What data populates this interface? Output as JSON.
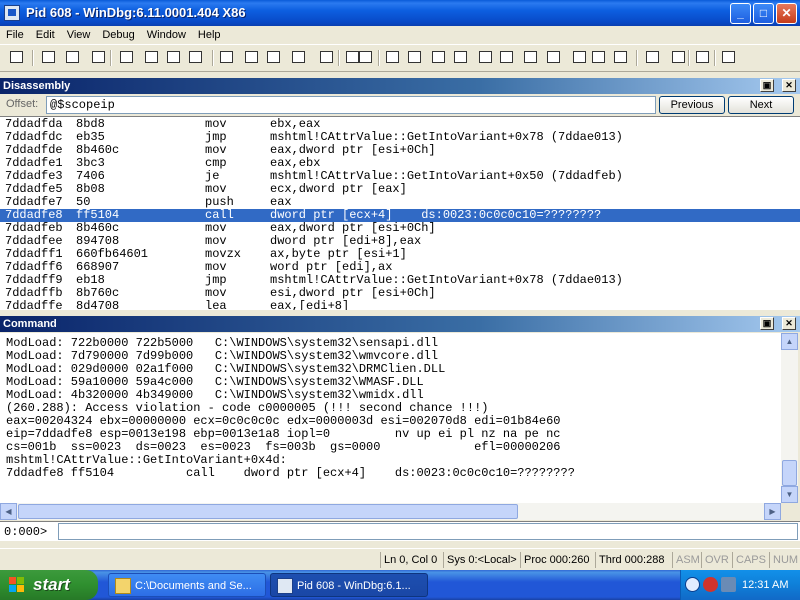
{
  "window": {
    "title": "Pid 608 - WinDbg:6.11.0001.404 X86",
    "controls": {
      "minimize": "_",
      "maximize": "□",
      "close": "✕"
    }
  },
  "menu": [
    "File",
    "Edit",
    "View",
    "Debug",
    "Window",
    "Help"
  ],
  "toolbar_icons": [
    "open-icon",
    "cut-icon",
    "copy-icon",
    "paste-icon",
    "step-into-icon",
    "step-over-icon",
    "step-out-icon",
    "run-to-cursor-icon",
    "go-icon",
    "restart-icon",
    "break-icon",
    "stop-icon",
    "step-in-source-icon",
    "step-over-source-icon",
    "step-out-source-icon",
    "source-mode-icon",
    "hand-icon",
    "command-window-icon",
    "watch-window-icon",
    "locals-window-icon",
    "registers-window-icon",
    "memory-window-icon",
    "call-stack-icon",
    "disassembly-icon",
    "scratch-pad-icon",
    "processes-icon",
    "source-mode-on-icon",
    "hex-display-icon",
    "font-icon",
    "options-icon"
  ],
  "disassembly": {
    "title": "Disassembly",
    "offset_label": "Offset:",
    "offset_value": "@$scopeip",
    "previous": "Previous",
    "next": "Next",
    "rows": [
      {
        "addr": "7ddadfda",
        "bytes": "8bd8",
        "op": "mov",
        "args": "ebx,eax",
        "sel": false
      },
      {
        "addr": "7ddadfdc",
        "bytes": "eb35",
        "op": "jmp",
        "args": "mshtml!CAttrValue::GetIntoVariant+0x78 (7ddae013)",
        "sel": false
      },
      {
        "addr": "7ddadfde",
        "bytes": "8b460c",
        "op": "mov",
        "args": "eax,dword ptr [esi+0Ch]",
        "sel": false
      },
      {
        "addr": "7ddadfe1",
        "bytes": "3bc3",
        "op": "cmp",
        "args": "eax,ebx",
        "sel": false
      },
      {
        "addr": "7ddadfe3",
        "bytes": "7406",
        "op": "je",
        "args": "mshtml!CAttrValue::GetIntoVariant+0x50 (7ddadfeb)",
        "sel": false
      },
      {
        "addr": "7ddadfe5",
        "bytes": "8b08",
        "op": "mov",
        "args": "ecx,dword ptr [eax]",
        "sel": false
      },
      {
        "addr": "7ddadfe7",
        "bytes": "50",
        "op": "push",
        "args": "eax",
        "sel": false
      },
      {
        "addr": "7ddadfe8",
        "bytes": "ff5104",
        "op": "call",
        "args": "dword ptr [ecx+4]    ds:0023:0c0c0c10=????????",
        "sel": true
      },
      {
        "addr": "7ddadfeb",
        "bytes": "8b460c",
        "op": "mov",
        "args": "eax,dword ptr [esi+0Ch]",
        "sel": false
      },
      {
        "addr": "7ddadfee",
        "bytes": "894708",
        "op": "mov",
        "args": "dword ptr [edi+8],eax",
        "sel": false
      },
      {
        "addr": "7ddadff1",
        "bytes": "660fb64601",
        "op": "movzx",
        "args": "ax,byte ptr [esi+1]",
        "sel": false
      },
      {
        "addr": "7ddadff6",
        "bytes": "668907",
        "op": "mov",
        "args": "word ptr [edi],ax",
        "sel": false
      },
      {
        "addr": "7ddadff9",
        "bytes": "eb18",
        "op": "jmp",
        "args": "mshtml!CAttrValue::GetIntoVariant+0x78 (7ddae013)",
        "sel": false
      },
      {
        "addr": "7ddadffb",
        "bytes": "8b760c",
        "op": "mov",
        "args": "esi,dword ptr [esi+0Ch]",
        "sel": false
      },
      {
        "addr": "7ddadffe",
        "bytes": "8d4708",
        "op": "lea",
        "args": "eax,[edi+8]",
        "sel": false
      }
    ]
  },
  "command": {
    "title": "Command",
    "lines": [
      "ModLoad: 722b0000 722b5000   C:\\WINDOWS\\system32\\sensapi.dll",
      "ModLoad: 7d790000 7d99b000   C:\\WINDOWS\\system32\\wmvcore.dll",
      "ModLoad: 029d0000 02a1f000   C:\\WINDOWS\\system32\\DRMClien.DLL",
      "ModLoad: 59a10000 59a4c000   C:\\WINDOWS\\system32\\WMASF.DLL",
      "ModLoad: 4b320000 4b349000   C:\\WINDOWS\\system32\\wmidx.dll",
      "(260.288): Access violation - code c0000005 (!!! second chance !!!)",
      "eax=00204324 ebx=00000000 ecx=0c0c0c0c edx=0000003d esi=002070d8 edi=01b84e60",
      "eip=7ddadfe8 esp=0013e198 ebp=0013e1a8 iopl=0         nv up ei pl nz na pe nc",
      "cs=001b  ss=0023  ds=0023  es=0023  fs=003b  gs=0000             efl=00000206",
      "mshtml!CAttrValue::GetIntoVariant+0x4d:",
      "7ddadfe8 ff5104          call    dword ptr [ecx+4]    ds:0023:0c0c0c10=????????"
    ],
    "prompt": "0:000>",
    "input_value": ""
  },
  "status": {
    "ln_col": "Ln 0, Col 0",
    "sys": "Sys 0:<Local>",
    "proc": "Proc 000:260",
    "thrd": "Thrd 000:288",
    "asm": "ASM",
    "ovr": "OVR",
    "caps": "CAPS",
    "num": "NUM"
  },
  "taskbar": {
    "start": "start",
    "tasks": [
      {
        "label": "C:\\Documents and Se...",
        "active": false
      },
      {
        "label": "Pid 608 - WinDbg:6.1...",
        "active": true
      }
    ],
    "clock": "12:31 AM"
  },
  "colors": {
    "selection": "#316ac5",
    "title_bar": "#0a5bd8",
    "pane_header": "#0a246a",
    "taskbar": "#2157d7",
    "start_button": "#2f8f2f"
  }
}
